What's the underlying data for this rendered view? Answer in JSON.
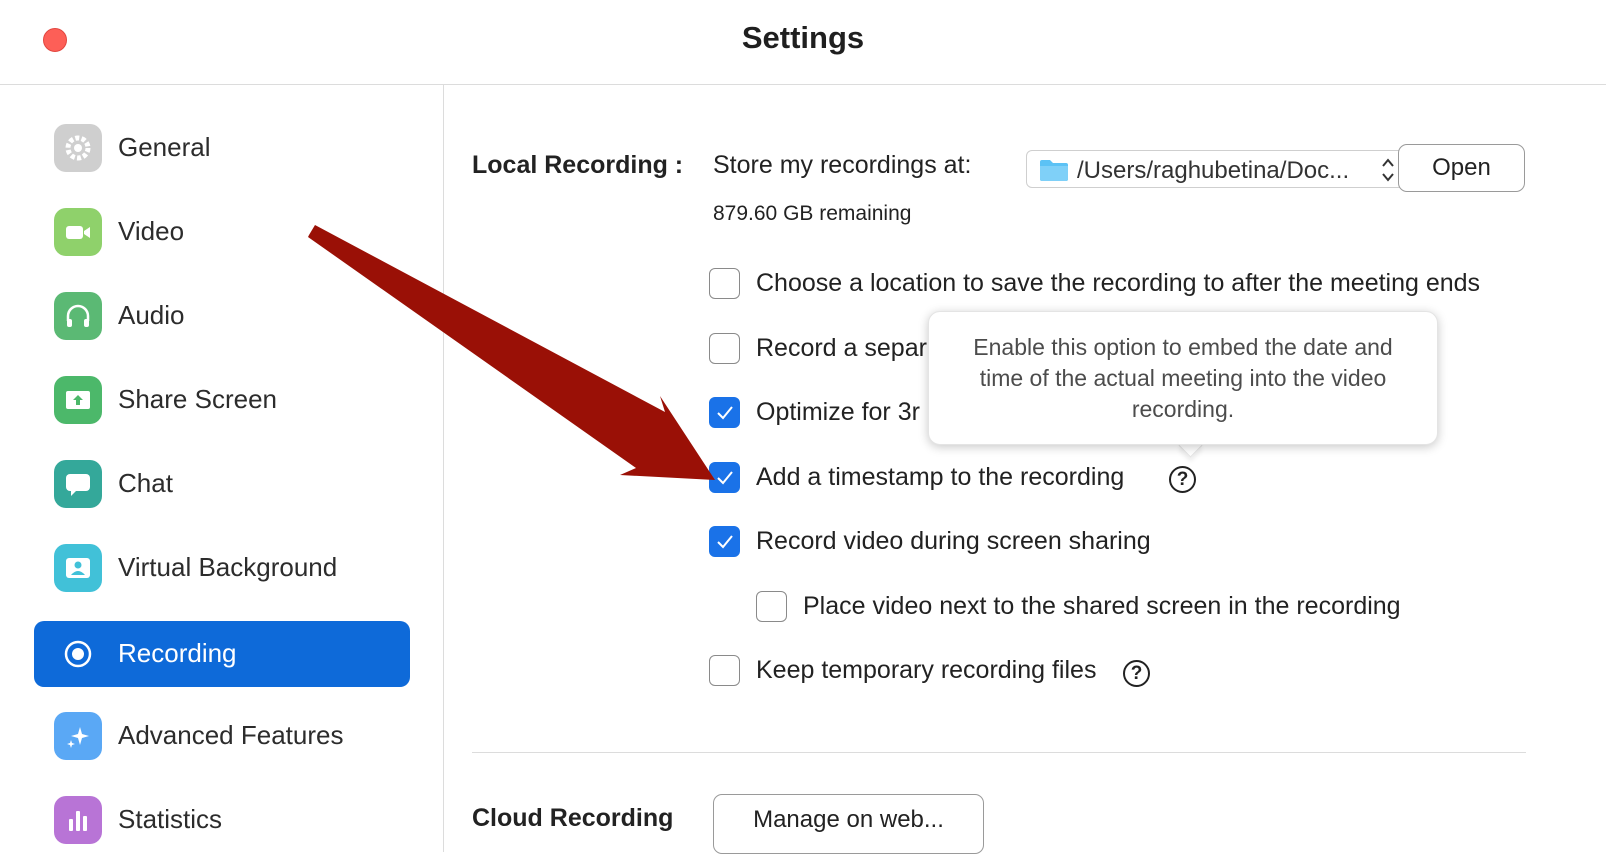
{
  "window": {
    "title": "Settings"
  },
  "sidebar": {
    "items": [
      {
        "label": "General",
        "icon": "gear-icon",
        "color": "#c9c9c9"
      },
      {
        "label": "Video",
        "icon": "video-camera-icon",
        "color": "#8fd16b"
      },
      {
        "label": "Audio",
        "icon": "headphones-icon",
        "color": "#5bb974"
      },
      {
        "label": "Share Screen",
        "icon": "share-screen-icon",
        "color": "#4cb86a"
      },
      {
        "label": "Chat",
        "icon": "chat-bubble-icon",
        "color": "#34a89a"
      },
      {
        "label": "Virtual Background",
        "icon": "person-portrait-icon",
        "color": "#41c1d8"
      },
      {
        "label": "Recording",
        "icon": "record-icon",
        "active": true
      },
      {
        "label": "Advanced Features",
        "icon": "sparkle-icon",
        "color": "#5aa8f5"
      },
      {
        "label": "Statistics",
        "icon": "bar-chart-icon",
        "color": "#b874d6"
      }
    ]
  },
  "local_recording": {
    "section_label": "Local Recording :",
    "store_label": "Store my recordings at:",
    "path": "/Users/raghubetina/Doc...",
    "open_button": "Open",
    "remaining": "879.60 GB remaining"
  },
  "options": [
    {
      "label": "Choose a location to save the recording to after the meeting ends",
      "checked": false
    },
    {
      "label": "Record a separ",
      "checked": false
    },
    {
      "label": "Optimize for 3r",
      "checked": true
    },
    {
      "label": "Add a timestamp to the recording",
      "checked": true,
      "help": "?"
    },
    {
      "label": "Record video during screen sharing",
      "checked": true
    },
    {
      "label": "Place video next to the shared screen in the recording",
      "checked": false
    },
    {
      "label": "Keep temporary recording files",
      "checked": false,
      "help": "?"
    }
  ],
  "tooltip": {
    "text": "Enable this option to embed the date and time of the actual meeting into the video recording."
  },
  "cloud_recording": {
    "section_label": "Cloud Recording",
    "manage_button": "Manage on web..."
  },
  "colors": {
    "accent": "#0e6ad9",
    "checkbox_checked": "#1a72e8",
    "close_button": "#fd5f57",
    "annotation_arrow": "#9a1006"
  }
}
